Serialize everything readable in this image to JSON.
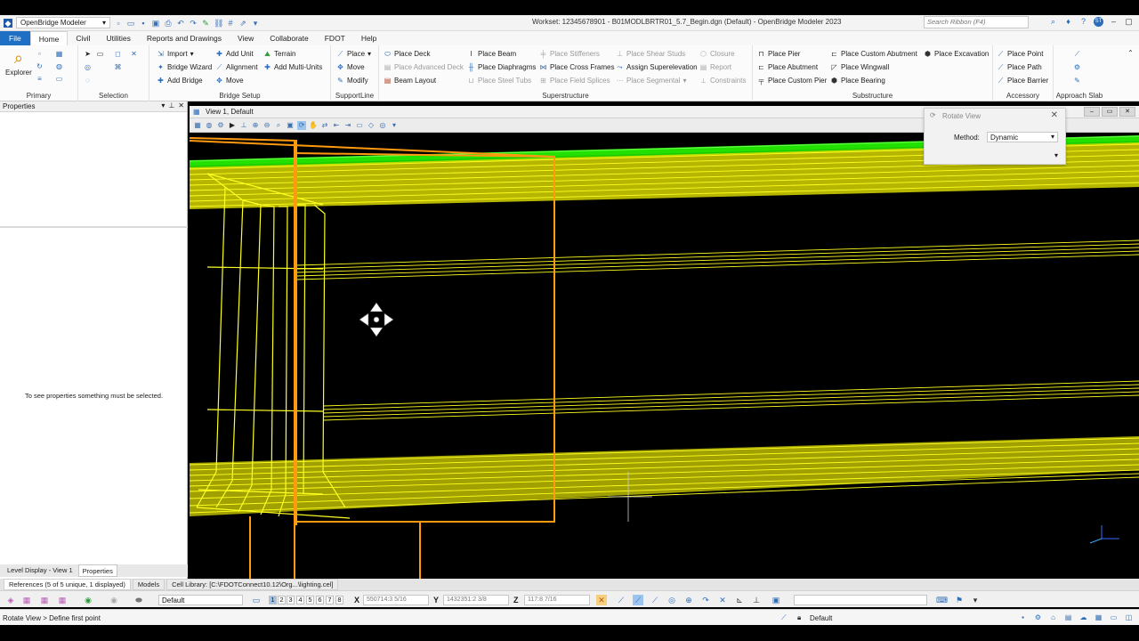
{
  "title_bar": {
    "workspace": "OpenBridge Modeler",
    "window_title": "Workset: 12345678901 - B01MODLBRTR01_5.7_Begin.dgn (Default) - OpenBridge Modeler 2023",
    "search_placeholder": "Search Ribbon (F4)",
    "user_initials": "ST"
  },
  "tabs": [
    "File",
    "Home",
    "Civil",
    "Utilities",
    "Reports and Drawings",
    "View",
    "Collaborate",
    "FDOT",
    "Help"
  ],
  "active_tab": "Home",
  "ribbon": {
    "primary": {
      "label": "Primary",
      "explorer": "Explorer"
    },
    "selection": {
      "label": "Selection"
    },
    "bridge_setup": {
      "label": "Bridge Setup",
      "items": [
        "Import",
        "Bridge Wizard",
        "Add Bridge",
        "Add Unit",
        "Alignment",
        "Move",
        "Terrain",
        "Add Multi-Units"
      ]
    },
    "supportline": {
      "label": "SupportLine",
      "items": [
        "Place",
        "Move",
        "Modify"
      ]
    },
    "superstructure": {
      "label": "Superstructure",
      "items": [
        "Place Deck",
        "Place Advanced Deck",
        "Beam Layout",
        "Place Beam",
        "Place Diaphragms",
        "Place Steel Tubs",
        "Place Stiffeners",
        "Place Cross Frames",
        "Place Field Splices",
        "Place Shear Studs",
        "Assign Superelevation",
        "Place Segmental",
        "Closure",
        "Report",
        "Constraints"
      ]
    },
    "substructure": {
      "label": "Substructure",
      "items": [
        "Place Pier",
        "Place Abutment",
        "Place Custom Pier",
        "Place Custom Abutment",
        "Place Wingwall",
        "Place Bearing",
        "Place Excavation"
      ]
    },
    "accessory": {
      "label": "Accessory",
      "items": [
        "Place Point",
        "Place Path",
        "Place Barrier"
      ]
    },
    "approach_slab": {
      "label": "Approach Slab"
    }
  },
  "properties_panel": {
    "title": "Properties",
    "empty_message": "To see properties something must be selected.",
    "tabs": [
      "Level Display - View 1",
      "Properties"
    ]
  },
  "view": {
    "title": "View 1, Default"
  },
  "rotate_dialog": {
    "title": "Rotate View",
    "method_label": "Method:",
    "method_value": "Dynamic"
  },
  "bottom_tabs": [
    "References (5 of 5 unique, 1 displayed)",
    "Models",
    "Cell Library: [C:\\FDOTConnect10.12\\Org...\\lighting.cel]"
  ],
  "accudraw": {
    "level": "Default",
    "view_numbers": [
      "1",
      "2",
      "3",
      "4",
      "5",
      "6",
      "7",
      "8"
    ],
    "x_label": "X",
    "x_value": "550714:3 5/16",
    "y_label": "Y",
    "y_value": "1432351:2 3/8",
    "z_label": "Z",
    "z_value": "117:8 7/16"
  },
  "status_bar": {
    "prompt": "Rotate View > Define first point",
    "level": "Default"
  },
  "colors": {
    "file_tab": "#1f6fc5",
    "wire_yellow": "#ffff20",
    "wire_orange": "#ff9a10",
    "deck_green": "#22e000",
    "viewport_bg": "#000000"
  }
}
